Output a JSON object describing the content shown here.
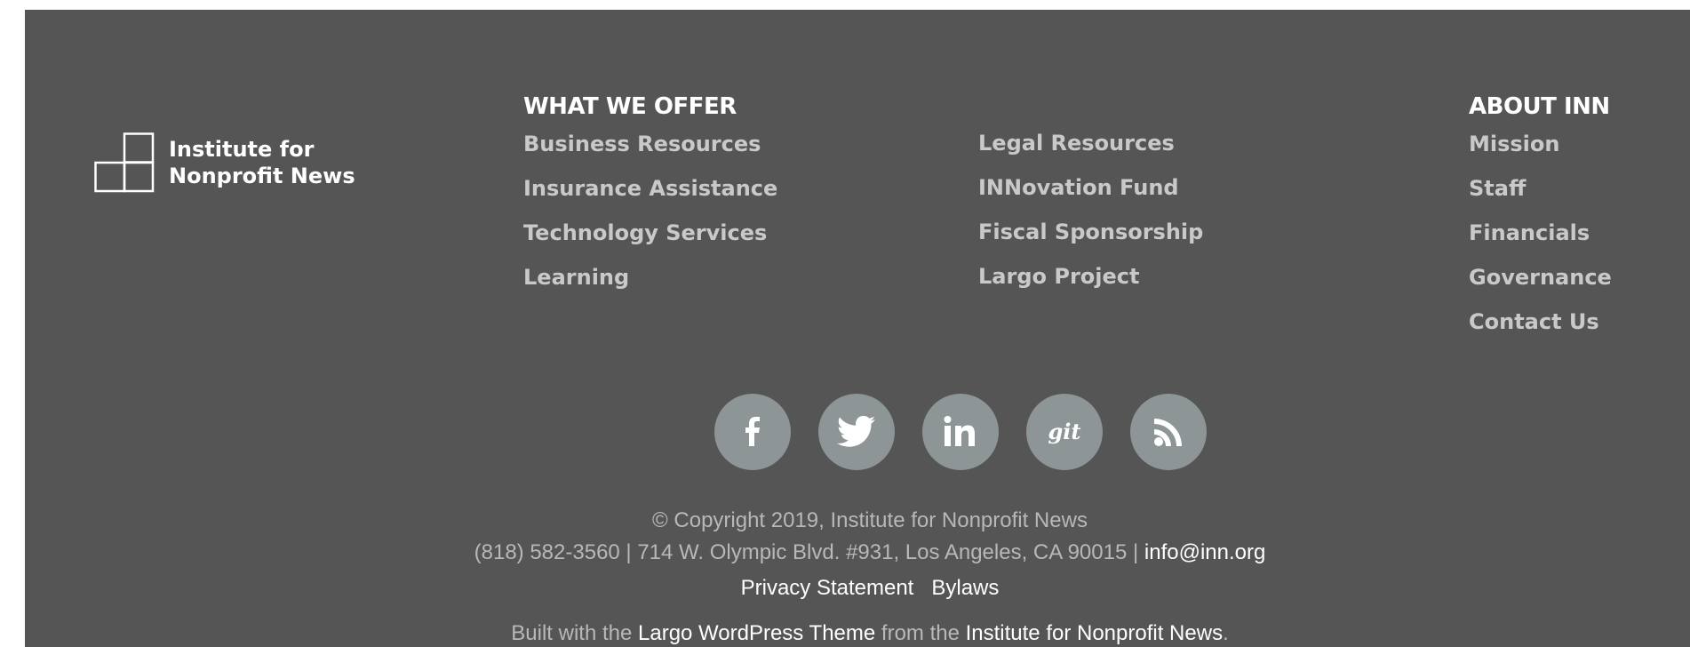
{
  "logo": {
    "line1": "Institute for",
    "line2": "Nonprofit News"
  },
  "offer": {
    "heading": "WHAT WE OFFER",
    "col1": [
      "Business Resources",
      "Insurance Assistance",
      "Technology Services",
      "Learning"
    ],
    "col2": [
      "Legal Resources",
      "INNovation Fund",
      "Fiscal Sponsorship",
      "Largo Project"
    ]
  },
  "about": {
    "heading": "ABOUT INN",
    "links": [
      "Mission",
      "Staff",
      "Financials",
      "Governance",
      "Contact Us"
    ]
  },
  "social": {
    "facebook": "f",
    "twitter": "twitter",
    "linkedin": "in",
    "github": "git",
    "rss": "rss"
  },
  "copyright": "© Copyright 2019, Institute for Nonprofit News",
  "address": "(818) 582-3560 | 714 W. Olympic Blvd. #931, Los Angeles, CA 90015 | ",
  "email": "info@inn.org",
  "legal": {
    "privacy": "Privacy Statement",
    "bylaws": "Bylaws"
  },
  "credit": {
    "prefix": "Built with the ",
    "theme": "Largo WordPress Theme",
    "middle": " from the ",
    "org": "Institute for Nonprofit News",
    "suffix": "."
  }
}
